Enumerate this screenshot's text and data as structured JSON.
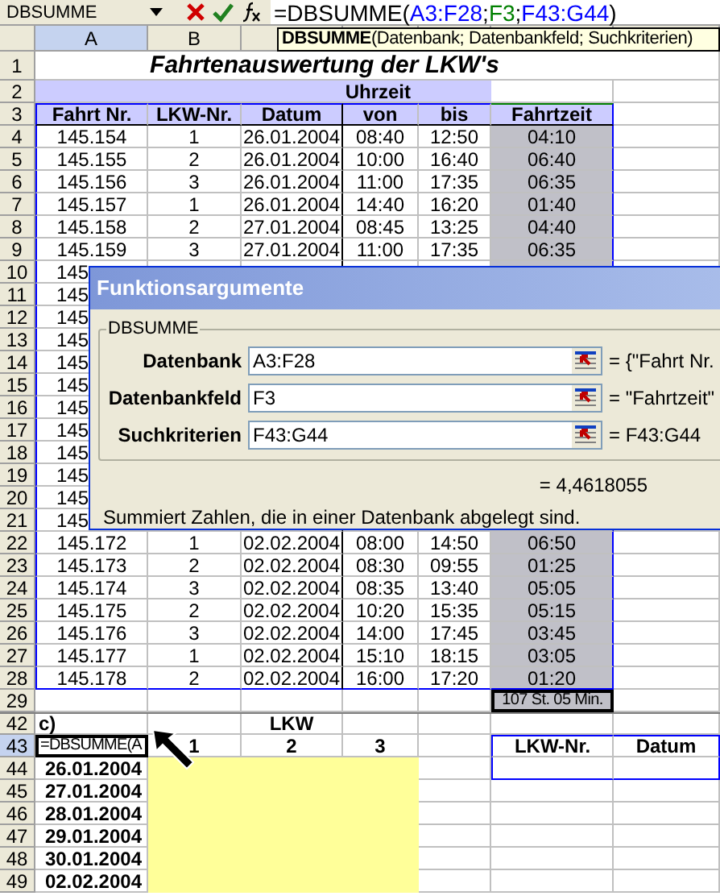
{
  "formula_bar": {
    "name_box": "DBSUMME",
    "formula": [
      {
        "text": "=DBSUMME(",
        "color": "#000000"
      },
      {
        "text": "A3:F28",
        "color": "#0000ff"
      },
      {
        "text": ";",
        "color": "#000000"
      },
      {
        "text": "F3",
        "color": "#008000"
      },
      {
        "text": ";",
        "color": "#000000"
      },
      {
        "text": "F43:G44",
        "color": "#0000ff"
      },
      {
        "text": ")",
        "color": "#000000"
      }
    ]
  },
  "tooltip": {
    "text": "**DBSUMME**(Datenbank; Datenbankfeld; Suchkriterien)"
  },
  "columns": [
    {
      "label": "A",
      "selected": true
    },
    {
      "label": "B",
      "selected": false
    }
  ],
  "title_row": {
    "number": "1",
    "text": "Fahrtenauswertung der LKW's"
  },
  "group_row": {
    "number": "2",
    "text": "Uhrzeit"
  },
  "header_row": {
    "number": "3",
    "cells": [
      "Fahrt Nr.",
      "LKW-Nr.",
      "Datum",
      "von",
      "bis",
      "Fahrtzeit"
    ]
  },
  "data_rows": [
    {
      "number": "4",
      "cells": [
        "145.154",
        "1",
        "26.01.2004",
        "08:40",
        "12:50",
        "04:10"
      ]
    },
    {
      "number": "5",
      "cells": [
        "145.155",
        "2",
        "26.01.2004",
        "10:00",
        "16:40",
        "06:40"
      ]
    },
    {
      "number": "6",
      "cells": [
        "145.156",
        "3",
        "26.01.2004",
        "11:00",
        "17:35",
        "06:35"
      ]
    },
    {
      "number": "7",
      "cells": [
        "145.157",
        "1",
        "26.01.2004",
        "14:40",
        "16:20",
        "01:40"
      ]
    },
    {
      "number": "8",
      "cells": [
        "145.158",
        "2",
        "27.01.2004",
        "08:45",
        "13:25",
        "04:40"
      ]
    },
    {
      "number": "9",
      "cells": [
        "145.159",
        "3",
        "27.01.2004",
        "11:00",
        "17:35",
        "06:35"
      ]
    },
    {
      "number": "10",
      "cells": [
        "145"
      ]
    },
    {
      "number": "11",
      "cells": [
        "145"
      ]
    },
    {
      "number": "12",
      "cells": [
        "145"
      ]
    },
    {
      "number": "13",
      "cells": [
        "145"
      ]
    },
    {
      "number": "14",
      "cells": [
        "145"
      ]
    },
    {
      "number": "15",
      "cells": [
        "145"
      ]
    },
    {
      "number": "16",
      "cells": [
        "145"
      ]
    },
    {
      "number": "17",
      "cells": [
        "145"
      ]
    },
    {
      "number": "18",
      "cells": [
        "145"
      ]
    },
    {
      "number": "19",
      "cells": [
        "145"
      ]
    },
    {
      "number": "20",
      "cells": [
        "145"
      ]
    },
    {
      "number": "21",
      "cells": [
        "145"
      ]
    },
    {
      "number": "22",
      "cells": [
        "145.172",
        "1",
        "02.02.2004",
        "08:00",
        "14:50",
        "06:50"
      ]
    },
    {
      "number": "23",
      "cells": [
        "145.173",
        "2",
        "02.02.2004",
        "08:30",
        "09:55",
        "01:25"
      ]
    },
    {
      "number": "24",
      "cells": [
        "145.174",
        "3",
        "02.02.2004",
        "08:35",
        "13:40",
        "05:05"
      ]
    },
    {
      "number": "25",
      "cells": [
        "145.175",
        "2",
        "02.02.2004",
        "10:20",
        "15:35",
        "05:15"
      ]
    },
    {
      "number": "26",
      "cells": [
        "145.176",
        "3",
        "02.02.2004",
        "14:00",
        "17:45",
        "03:45"
      ]
    },
    {
      "number": "27",
      "cells": [
        "145.177",
        "1",
        "02.02.2004",
        "15:10",
        "18:15",
        "03:05"
      ]
    },
    {
      "number": "28",
      "cells": [
        "145.178",
        "2",
        "02.02.2004",
        "16:00",
        "17:20",
        "01:20"
      ]
    }
  ],
  "total_row": {
    "number": "29",
    "text": "107 St. 05 Min."
  },
  "section_row": {
    "number": "42",
    "label": "c)",
    "group": "LKW"
  },
  "edit_row": {
    "number": "43",
    "selected": true,
    "edit": "=DBSUMME(A",
    "trucks": [
      "1",
      "2",
      "3"
    ],
    "criteria": [
      "LKW-Nr.",
      "Datum"
    ]
  },
  "date_rows": [
    {
      "number": "44",
      "date": "26.01.2004"
    },
    {
      "number": "45",
      "date": "27.01.2004"
    },
    {
      "number": "46",
      "date": "28.01.2004"
    },
    {
      "number": "47",
      "date": "29.01.2004"
    },
    {
      "number": "48",
      "date": "30.01.2004"
    },
    {
      "number": "49",
      "date": "02.02.2004"
    }
  ],
  "dialog": {
    "title": "Funktionsargumente",
    "group": "DBSUMME",
    "args": [
      {
        "label": "Datenbank",
        "value": "A3:F28",
        "result": "= {\"Fahrt Nr."
      },
      {
        "label": "Datenbankfeld",
        "value": "F3",
        "result": "= \"Fahrtzeit\""
      },
      {
        "label": "Suchkriterien",
        "value": "F43:G44",
        "result": "= F43:G44"
      }
    ],
    "result": "= 4,4618055",
    "description": "Summiert Zahlen, die in einer Datenbank abgelegt sind."
  }
}
